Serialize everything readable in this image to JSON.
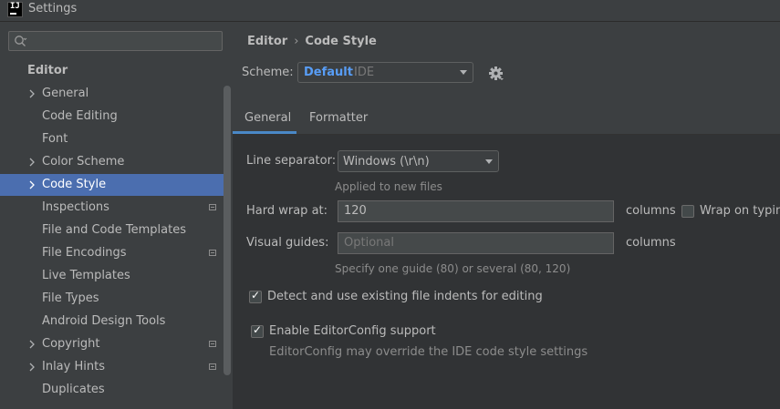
{
  "window": {
    "title": "Settings",
    "icon_text": "IJ"
  },
  "sidebar": {
    "search": {
      "value": "",
      "placeholder": ""
    },
    "section_title": "Editor",
    "items": [
      {
        "label": "General",
        "expandable": true
      },
      {
        "label": "Code Editing",
        "expandable": false
      },
      {
        "label": "Font",
        "expandable": false
      },
      {
        "label": "Color Scheme",
        "expandable": true
      },
      {
        "label": "Code Style",
        "expandable": true,
        "selected": true
      },
      {
        "label": "Inspections",
        "expandable": false,
        "project_icon": true
      },
      {
        "label": "File and Code Templates",
        "expandable": false
      },
      {
        "label": "File Encodings",
        "expandable": false,
        "project_icon": true
      },
      {
        "label": "Live Templates",
        "expandable": false
      },
      {
        "label": "File Types",
        "expandable": false
      },
      {
        "label": "Android Design Tools",
        "expandable": false
      },
      {
        "label": "Copyright",
        "expandable": true,
        "project_icon": true
      },
      {
        "label": "Inlay Hints",
        "expandable": true,
        "project_icon": true
      },
      {
        "label": "Duplicates",
        "expandable": false
      }
    ]
  },
  "breadcrumb": {
    "parent": "Editor",
    "separator": "›",
    "current": "Code Style"
  },
  "scheme": {
    "label": "Scheme:",
    "name": "Default",
    "type": "IDE"
  },
  "tabs": [
    {
      "label": "General",
      "active": true
    },
    {
      "label": "Formatter",
      "active": false
    }
  ],
  "general": {
    "line_separator": {
      "label": "Line separator:",
      "value": "Windows (\\r\\n)",
      "hint": "Applied to new files"
    },
    "hard_wrap": {
      "label": "Hard wrap at:",
      "value": "120",
      "unit": "columns",
      "wrap_on_typing_label": "Wrap on typing",
      "wrap_on_typing_checked": false
    },
    "visual_guides": {
      "label": "Visual guides:",
      "placeholder": "Optional",
      "unit": "columns",
      "hint": "Specify one guide (80) or several (80, 120)"
    },
    "detect_indents": {
      "label": "Detect and use existing file indents for editing",
      "checked": true
    },
    "editorconfig": {
      "label": "Enable EditorConfig support",
      "checked": true,
      "hint": "EditorConfig may override the IDE code style settings"
    }
  },
  "colors": {
    "background": "#3c3f41",
    "content_background": "#313335",
    "selection": "#4b6eaf",
    "accent": "#4a88c7",
    "link": "#589df6",
    "text": "#bbbbbb",
    "muted": "#8c8c8c"
  },
  "icons": {
    "search": "search-icon",
    "gear": "gear-icon",
    "chevron": "chevron-right-icon",
    "project": "project-level-icon",
    "dropdown": "chevron-down-icon",
    "check": "check-icon"
  }
}
